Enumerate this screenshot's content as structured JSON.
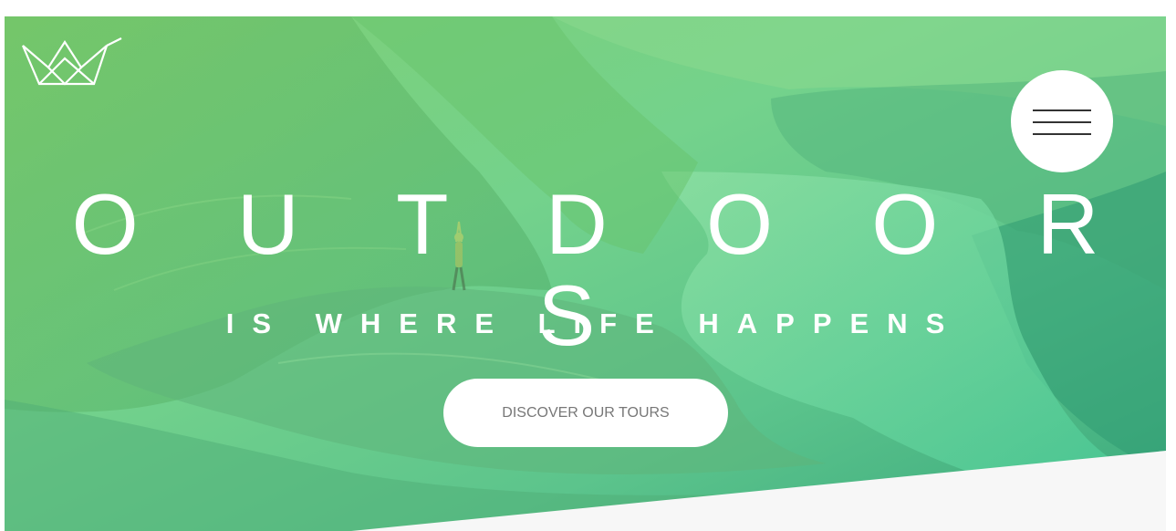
{
  "hero": {
    "heading": "O U T D O O R S",
    "subheading": "IS WHERE LIFE HAPPENS",
    "cta_label": "DISCOVER OUR TOURS",
    "overlay_colors": [
      "#7ed56f",
      "#28b485"
    ]
  },
  "header": {
    "logo_icon": "crown-logo-icon",
    "menu_icon": "hamburger-menu-icon"
  },
  "section_below": {
    "background_color": "#f7f7f7"
  }
}
